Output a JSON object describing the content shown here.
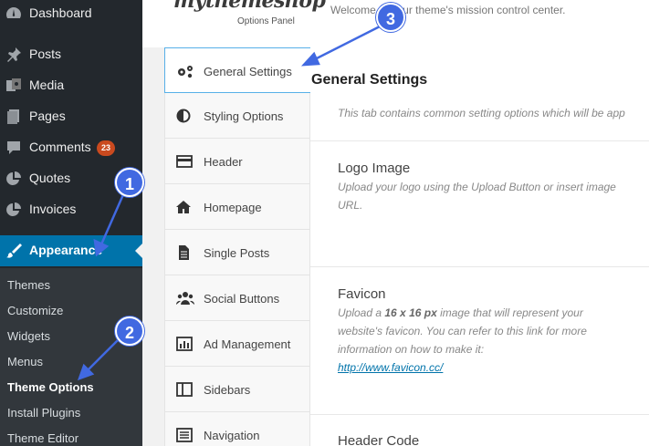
{
  "sidebar": {
    "items": [
      {
        "label": "Dashboard",
        "icon": "dashboard-icon"
      },
      {
        "label": "Posts",
        "icon": "pin-icon"
      },
      {
        "label": "Media",
        "icon": "media-icon"
      },
      {
        "label": "Pages",
        "icon": "pages-icon"
      },
      {
        "label": "Comments",
        "icon": "comment-icon",
        "badge": "23"
      },
      {
        "label": "Quotes",
        "icon": "pie-icon"
      },
      {
        "label": "Invoices",
        "icon": "pie-icon"
      },
      {
        "label": "Appearance",
        "icon": "brush-icon",
        "active": true
      }
    ],
    "submenu": [
      "Themes",
      "Customize",
      "Widgets",
      "Menus",
      "Theme Options",
      "Install Plugins",
      "Theme Editor"
    ],
    "submenu_current": "Theme Options"
  },
  "panel": {
    "logo": "mythemeshop",
    "logo_sub": "Options Panel",
    "welcome": "Welcome to your theme's mission control center.",
    "tabs": [
      {
        "label": "General Settings",
        "icon": "gears-icon",
        "active": true
      },
      {
        "label": "Styling Options",
        "icon": "contrast-icon"
      },
      {
        "label": "Header",
        "icon": "header-icon"
      },
      {
        "label": "Homepage",
        "icon": "home-icon"
      },
      {
        "label": "Single Posts",
        "icon": "document-icon"
      },
      {
        "label": "Social Buttons",
        "icon": "users-icon"
      },
      {
        "label": "Ad Management",
        "icon": "chart-icon"
      },
      {
        "label": "Sidebars",
        "icon": "columns-icon"
      },
      {
        "label": "Navigation",
        "icon": "list-icon"
      }
    ]
  },
  "main": {
    "title": "General Settings",
    "intro": "This tab contains common setting options which will be app",
    "sections": {
      "logo": {
        "title": "Logo Image",
        "desc": "Upload your logo using the Upload Button or insert image URL."
      },
      "favicon": {
        "title": "Favicon",
        "desc_pre": "Upload a ",
        "desc_bold": "16 x 16 px",
        "desc_post": " image that will represent your website's favicon. You can refer to this link for more information on how to make it:",
        "link": "http://www.favicon.cc/"
      },
      "header_code": {
        "title": "Header Code"
      }
    }
  },
  "callouts": [
    "1",
    "2",
    "3"
  ],
  "colors": {
    "wp_sidebar": "#23282d",
    "wp_active": "#0073aa",
    "badge": "#ca4a1f",
    "callout": "#4169e1"
  }
}
